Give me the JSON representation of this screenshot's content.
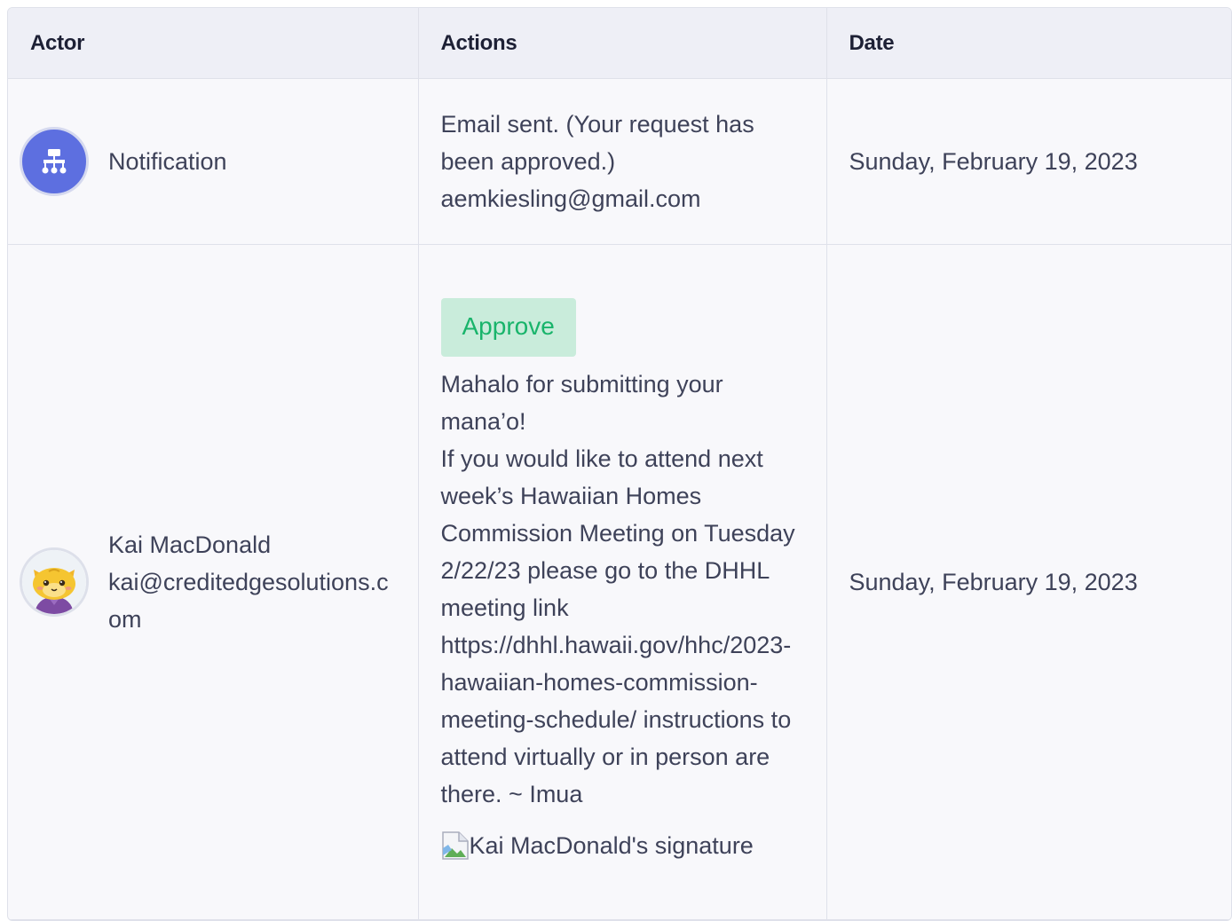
{
  "table": {
    "headers": {
      "actor": "Actor",
      "actions": "Actions",
      "date": "Date"
    },
    "rows": [
      {
        "actor": {
          "name": "Notification",
          "avatar_icon": "sitemap-icon",
          "avatar_color": "#5d6fe0"
        },
        "action_lines": [
          "Email sent. (Your request has",
          "been approved.)",
          "aemkiesling@gmail.com"
        ],
        "date": "Sunday, February 19, 2023"
      },
      {
        "actor": {
          "name": "Kai MacDonald",
          "email": "kai@creditedgesolutions.com",
          "avatar_icon": "cat-avatar-icon"
        },
        "status_badge": "Approve",
        "status_color": "#19b46b",
        "comment": "Mahalo for submitting your mana’o!",
        "comment_body": "If you would like to attend next week’s Hawaiian Homes Commission Meeting on Tuesday 2/22/23 please go to the DHHL meeting link https://dhhl.hawaii.gov/hhc/2023-hawaiian-homes-commission-meeting-schedule/ instructions to attend virtually or in person are there. ~ Imua",
        "signature_alt": "Kai MacDonald's signature",
        "date": "Sunday, February 19, 2023"
      }
    ]
  }
}
